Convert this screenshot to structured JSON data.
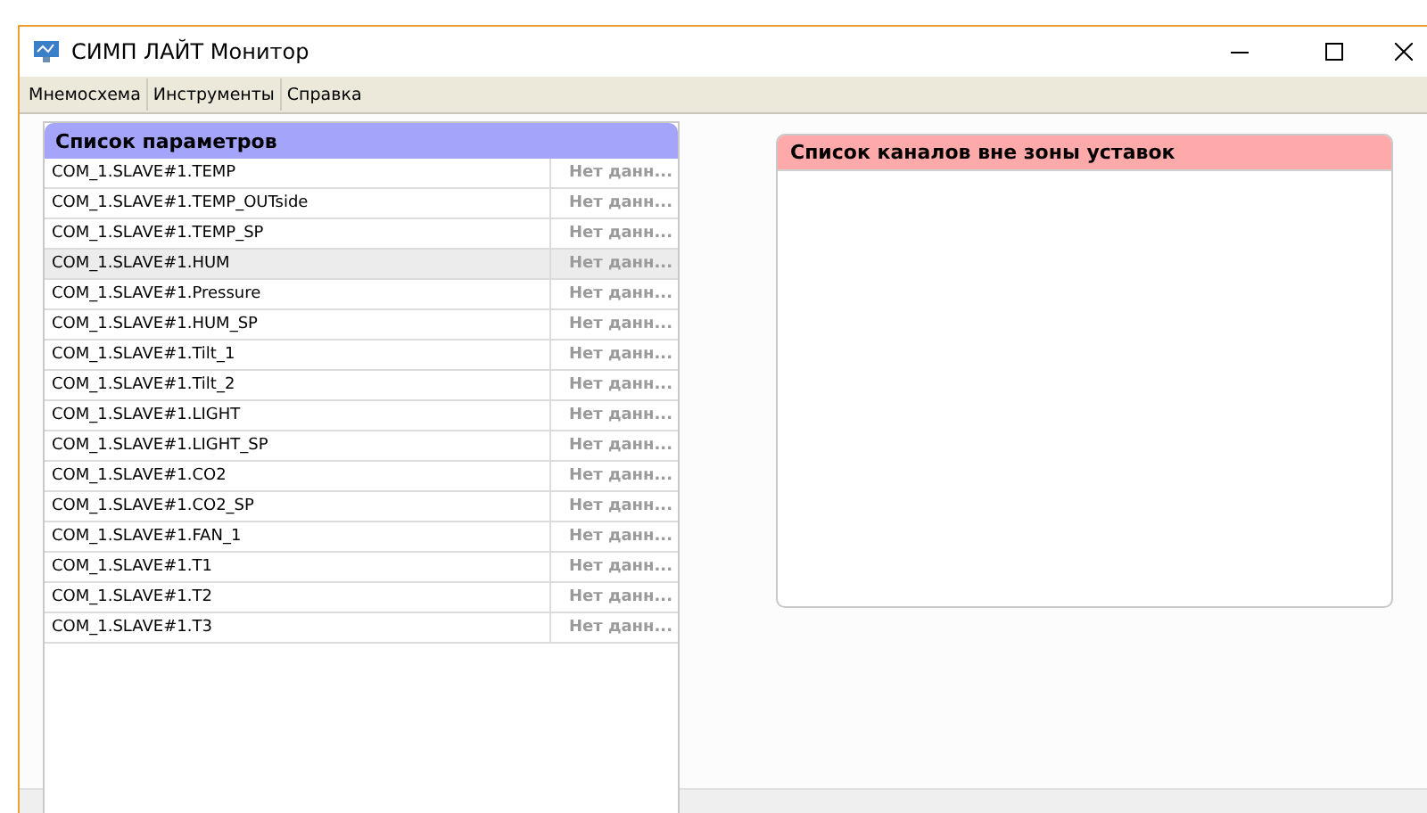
{
  "window": {
    "title": "СИМП ЛАЙТ Монитор"
  },
  "menu": [
    {
      "label": "Мнемосхема"
    },
    {
      "label": "Инструменты"
    },
    {
      "label": "Справка"
    }
  ],
  "parameters": {
    "title": "Список параметров",
    "rows": [
      {
        "name": "COM_1.SLAVE#1.TEMP",
        "value": "Нет данн...",
        "selected": false
      },
      {
        "name": "COM_1.SLAVE#1.TEMP_OUTside",
        "value": "Нет данн...",
        "selected": false
      },
      {
        "name": "COM_1.SLAVE#1.TEMP_SP",
        "value": "Нет данн...",
        "selected": false
      },
      {
        "name": "COM_1.SLAVE#1.HUM",
        "value": "Нет данн...",
        "selected": true
      },
      {
        "name": "COM_1.SLAVE#1.Pressure",
        "value": "Нет данн...",
        "selected": false
      },
      {
        "name": "COM_1.SLAVE#1.HUM_SP",
        "value": "Нет данн...",
        "selected": false
      },
      {
        "name": "COM_1.SLAVE#1.Tilt_1",
        "value": "Нет данн...",
        "selected": false
      },
      {
        "name": "COM_1.SLAVE#1.Tilt_2",
        "value": "Нет данн...",
        "selected": false
      },
      {
        "name": "COM_1.SLAVE#1.LIGHT",
        "value": "Нет данн...",
        "selected": false
      },
      {
        "name": "COM_1.SLAVE#1.LIGHT_SP",
        "value": "Нет данн...",
        "selected": false
      },
      {
        "name": "COM_1.SLAVE#1.CO2",
        "value": "Нет данн...",
        "selected": false
      },
      {
        "name": "COM_1.SLAVE#1.CO2_SP",
        "value": "Нет данн...",
        "selected": false
      },
      {
        "name": "COM_1.SLAVE#1.FAN_1",
        "value": "Нет данн...",
        "selected": false
      },
      {
        "name": "COM_1.SLAVE#1.T1",
        "value": "Нет данн...",
        "selected": false
      },
      {
        "name": "COM_1.SLAVE#1.T2",
        "value": "Нет данн...",
        "selected": false
      },
      {
        "name": "COM_1.SLAVE#1.T3",
        "value": "Нет данн...",
        "selected": false
      }
    ]
  },
  "alarms": {
    "title": "Список каналов вне зоны уставок"
  }
}
